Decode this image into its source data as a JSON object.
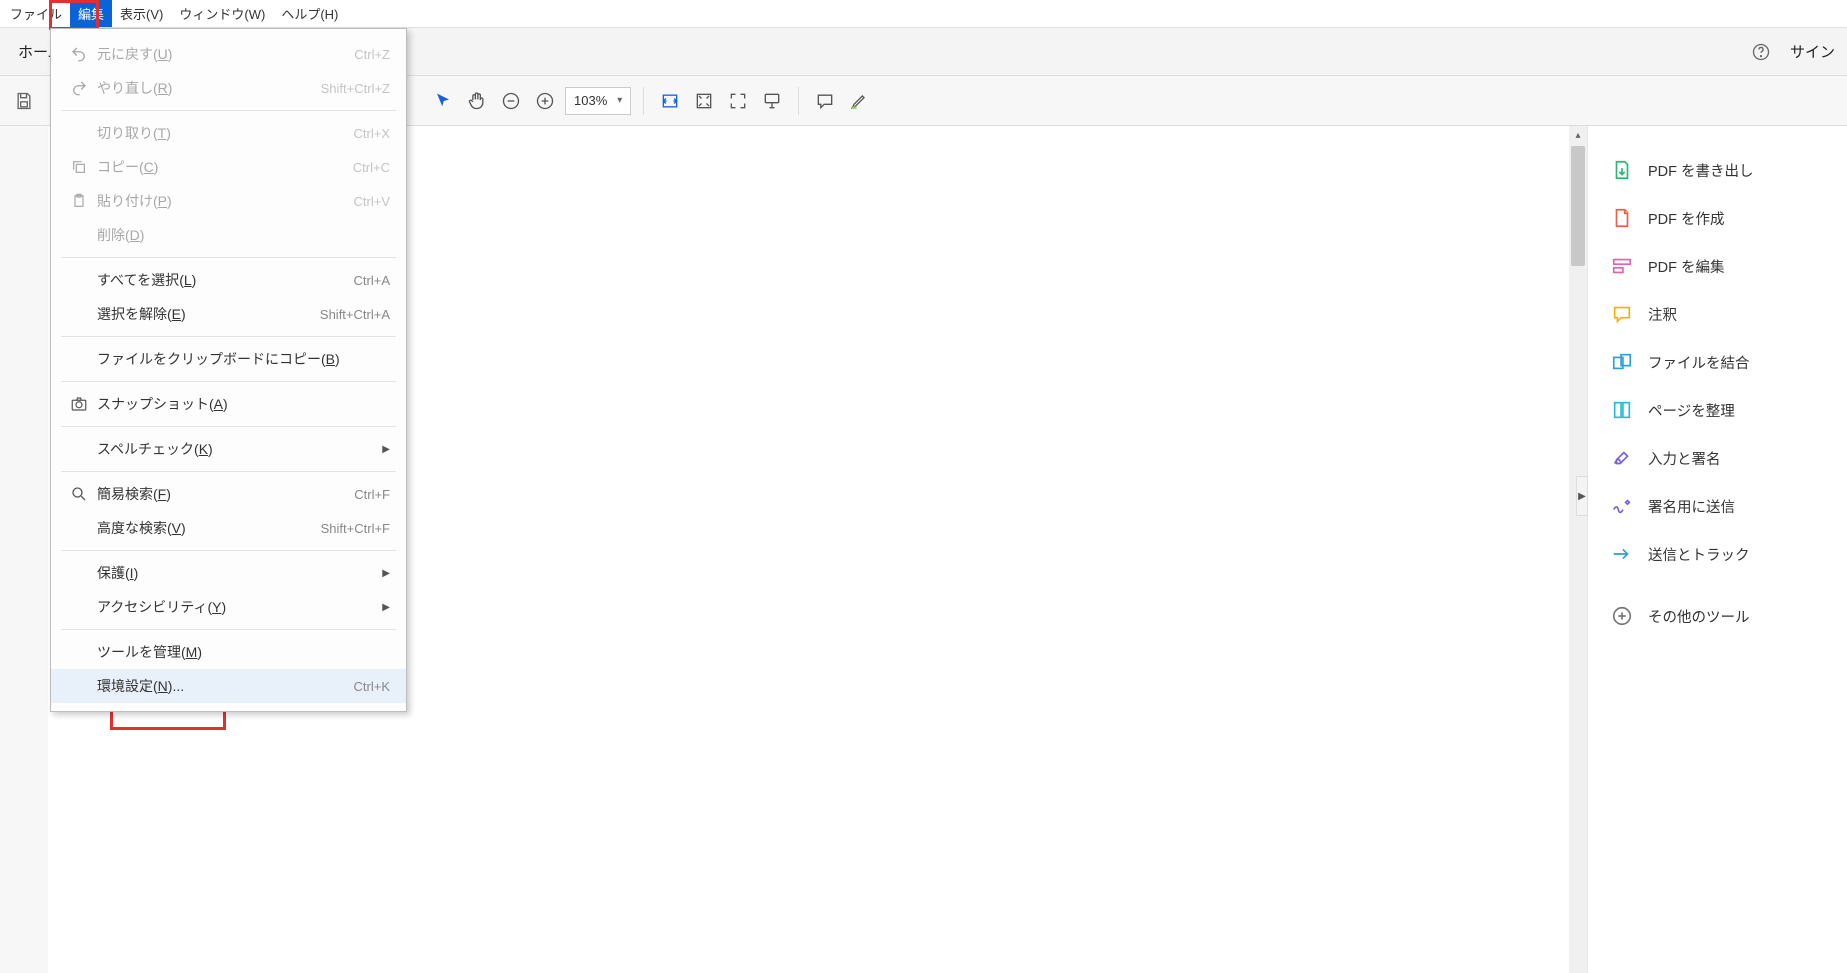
{
  "menubar": {
    "file": "ファイル",
    "edit": "編集",
    "view": "表示(V)",
    "window": "ウィンドウ(W)",
    "help": "ヘルプ(H)"
  },
  "tabbar": {
    "home": "ホーム",
    "signin": "サイン"
  },
  "toolbar": {
    "zoom": "103%"
  },
  "dropdown": {
    "undo": {
      "label": "元に戻す",
      "accel": "U",
      "shortcut": "Ctrl+Z"
    },
    "redo": {
      "label": "やり直し",
      "accel": "R",
      "shortcut": "Shift+Ctrl+Z"
    },
    "cut": {
      "label": "切り取り",
      "accel": "T",
      "shortcut": "Ctrl+X"
    },
    "copy": {
      "label": "コピー",
      "accel": "C",
      "shortcut": "Ctrl+C"
    },
    "paste": {
      "label": "貼り付け",
      "accel": "P",
      "shortcut": "Ctrl+V"
    },
    "delete": {
      "label": "削除",
      "accel": "D",
      "shortcut": ""
    },
    "selectall": {
      "label": "すべてを選択",
      "accel": "L",
      "shortcut": "Ctrl+A"
    },
    "deselect": {
      "label": "選択を解除",
      "accel": "E",
      "shortcut": "Shift+Ctrl+A"
    },
    "copyfile": {
      "label": "ファイルをクリップボードにコピー",
      "accel": "B",
      "shortcut": ""
    },
    "snapshot": {
      "label": "スナップショット",
      "accel": "A",
      "shortcut": ""
    },
    "spellcheck": {
      "label": "スペルチェック",
      "accel": "K",
      "shortcut": ""
    },
    "find": {
      "label": "簡易検索",
      "accel": "F",
      "shortcut": "Ctrl+F"
    },
    "advfind": {
      "label": "高度な検索",
      "accel": "V",
      "shortcut": "Shift+Ctrl+F"
    },
    "protection": {
      "label": "保護",
      "accel": "I",
      "shortcut": ""
    },
    "accessibility": {
      "label": "アクセシビリティ",
      "accel": "Y",
      "shortcut": ""
    },
    "managetools": {
      "label": "ツールを管理",
      "accel": "M",
      "shortcut": ""
    },
    "preferences": {
      "label": "環境設定",
      "accel": "N",
      "suffix": "...",
      "shortcut": "Ctrl+K"
    }
  },
  "rightpanel": {
    "export": "PDF を書き出し",
    "create": "PDF を作成",
    "edit": "PDF を編集",
    "comment": "注釈",
    "combine": "ファイルを結合",
    "organize": "ページを整理",
    "fillsign": "入力と署名",
    "sendSig": "署名用に送信",
    "sendtrack": "送信とトラック",
    "more": "その他のツール"
  }
}
